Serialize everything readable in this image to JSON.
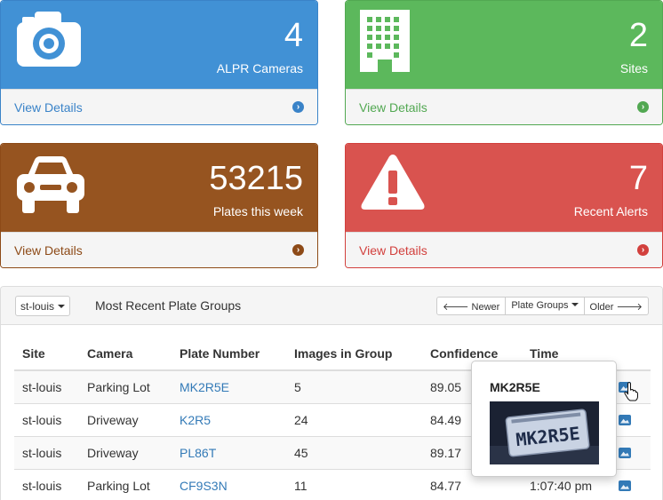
{
  "panels": {
    "cameras": {
      "count": "4",
      "label": "ALPR Cameras",
      "footer": "View Details",
      "icon": "camera-icon",
      "color": "#4191d5"
    },
    "sites": {
      "count": "2",
      "label": "Sites",
      "footer": "View Details",
      "icon": "building-icon",
      "color": "#5cb85c"
    },
    "plates": {
      "count": "53215",
      "label": "Plates this week",
      "footer": "View Details",
      "icon": "car-icon",
      "color": "#965420"
    },
    "alerts": {
      "count": "7",
      "label": "Recent Alerts",
      "footer": "View Details",
      "icon": "warning-icon",
      "color": "#d9534f"
    }
  },
  "groups": {
    "site_select": "st-louis",
    "title": "Most Recent Plate Groups",
    "buttons": {
      "newer": "Newer",
      "plate_groups": "Plate Groups",
      "older": "Older"
    },
    "columns": [
      "Site",
      "Camera",
      "Plate Number",
      "Images in Group",
      "Confidence",
      "Time"
    ],
    "rows": [
      {
        "site": "st-louis",
        "camera": "Parking Lot",
        "plate": "MK2R5E",
        "images": "5",
        "confidence": "89.05",
        "time": ""
      },
      {
        "site": "st-louis",
        "camera": "Driveway",
        "plate": "K2R5",
        "images": "24",
        "confidence": "84.49",
        "time": ""
      },
      {
        "site": "st-louis",
        "camera": "Driveway",
        "plate": "PL86T",
        "images": "45",
        "confidence": "89.17",
        "time": ""
      },
      {
        "site": "st-louis",
        "camera": "Parking Lot",
        "plate": "CF9S3N",
        "images": "11",
        "confidence": "84.77",
        "time": "1:07:40 pm"
      }
    ]
  },
  "popover": {
    "title": "MK2R5E",
    "plate_text": "MK2R5E"
  }
}
